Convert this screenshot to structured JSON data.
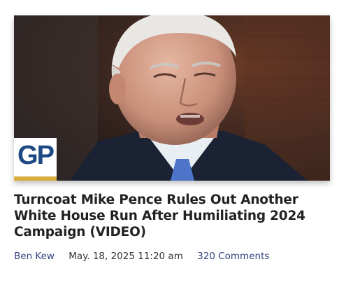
{
  "article": {
    "headline": "Turncoat Mike Pence Rules Out Another White House Run After Humiliating 2024 Campaign (VIDEO)",
    "author": "Ben Kew",
    "date": "May. 18, 2025 11:20 am",
    "comments": "320 Comments"
  },
  "logo": {
    "text": "GP",
    "brand_color": "#1d4a84",
    "accent_color": "#d9ad3c"
  },
  "colors": {
    "link": "#33437f",
    "headline": "#222222"
  }
}
